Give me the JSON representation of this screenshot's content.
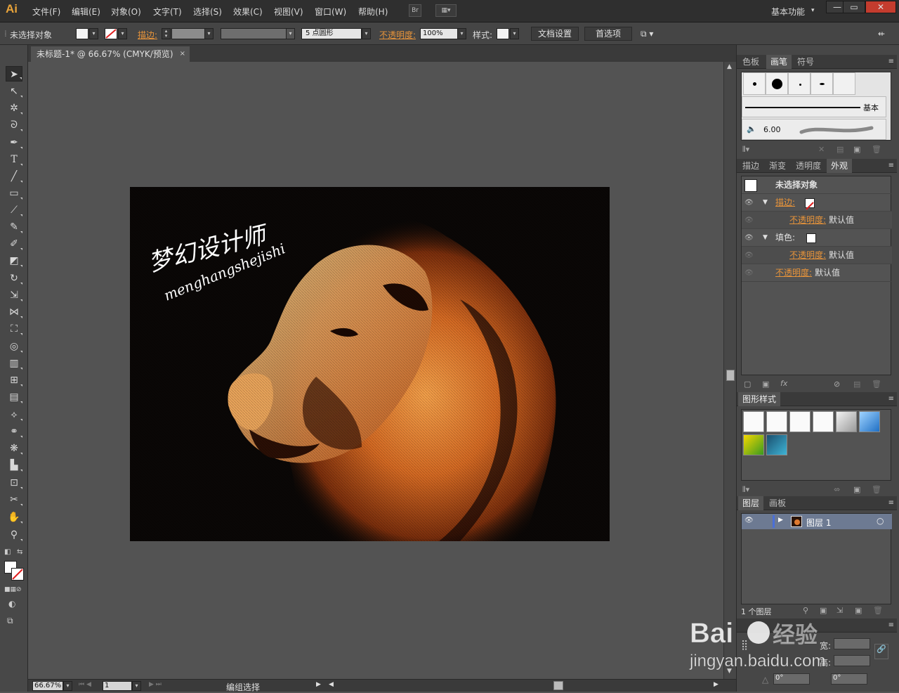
{
  "app": {
    "logo": "Ai"
  },
  "menu": {
    "items": [
      "文件(F)",
      "编辑(E)",
      "对象(O)",
      "文字(T)",
      "选择(S)",
      "效果(C)",
      "视图(V)",
      "窗口(W)",
      "帮助(H)"
    ],
    "bridge_label": "Br",
    "workspace": "基本功能",
    "window_buttons": [
      "—",
      "▭",
      "✕"
    ]
  },
  "control": {
    "selection_status": "未选择对象",
    "stroke_label": "描边:",
    "brush_def_value": "5 点圆形",
    "opacity_label": "不透明度:",
    "opacity_value": "100%",
    "style_label": "样式:",
    "doc_setup": "文档设置",
    "preferences": "首选项"
  },
  "document": {
    "tab_title": "未标题-1* @ 66.67% (CMYK/预览)",
    "tab_close": "×"
  },
  "artwork": {
    "calligraphy_cn": "梦幻设计师",
    "calligraphy_pinyin": "menghangshejishi"
  },
  "status": {
    "zoom": "66.67%",
    "artboard_num": "1",
    "tool_status": "编组选择"
  },
  "panels": {
    "brushes": {
      "tabs": [
        "色板",
        "画笔",
        "符号"
      ],
      "active": "画笔",
      "basic_label": "基本",
      "size_value": "6.00"
    },
    "appearance": {
      "tabs": [
        "描边",
        "渐变",
        "透明度",
        "外观"
      ],
      "active": "外观",
      "header": "未选择对象",
      "stroke_label": "描边:",
      "fill_label": "填色:",
      "opacity_label": "不透明度:",
      "default_value": "默认值",
      "fx_label": "fx"
    },
    "graphic_styles": {
      "tabs": [
        "图形样式"
      ],
      "swatch_colors": [
        "#ffffff",
        "#ffffff",
        "#ffffff",
        "#ffffff",
        "#d8d8d8",
        "#4a9ee0",
        "#8cc83a",
        "#2d8aa8"
      ]
    },
    "layers": {
      "tabs": [
        "图层",
        "画板"
      ],
      "layer_name": "图层 1",
      "footer_count": "1 个图层",
      "highlight_color": "#6d7a92"
    },
    "transform": {
      "width_label": "宽:",
      "height_label": "高:",
      "angle_1": "0°",
      "angle_2": "0°"
    }
  },
  "watermark": {
    "brand": "Bai",
    "brand_cn": "经验",
    "url": "jingyan.baidu.com"
  }
}
